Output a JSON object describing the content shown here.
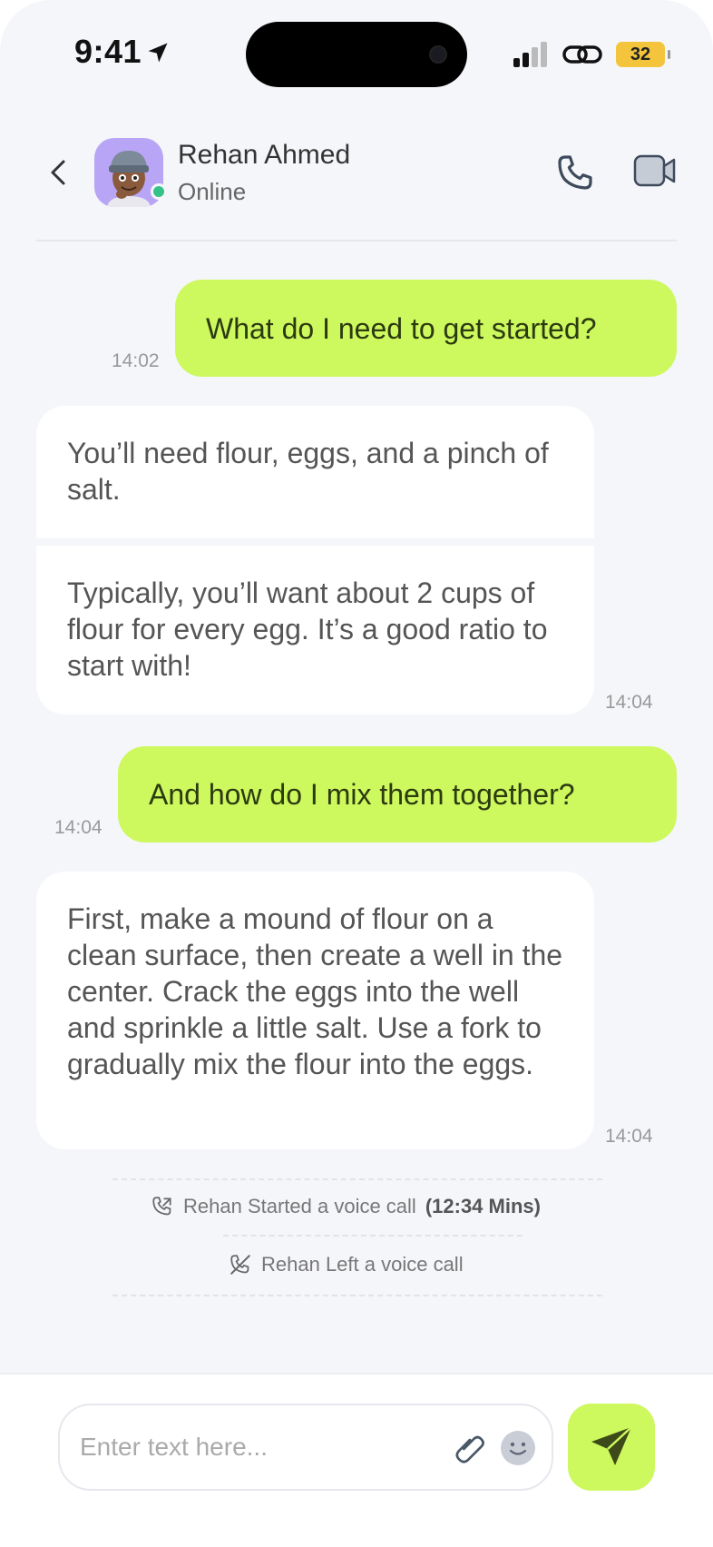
{
  "status_bar": {
    "time": "9:41",
    "battery": "32"
  },
  "header": {
    "contact_name": "Rehan Ahmed",
    "status": "Online"
  },
  "messages": [
    {
      "from": "me",
      "text": "What do I need to get started?",
      "time": "14:02"
    },
    {
      "from": "contact",
      "parts": [
        "You’ll need flour, eggs, and a pinch of salt.",
        "Typically, you’ll want about 2 cups of flour for every egg. It’s a good ratio to start with!"
      ],
      "time": "14:04"
    },
    {
      "from": "me",
      "text": "And how do I mix them together?",
      "time": "14:04"
    },
    {
      "from": "contact",
      "parts": [
        "First, make a mound of flour on a clean surface, then create a well in the center. Crack the eggs into the well and sprinkle a little salt. Use a fork to gradually mix the flour into the eggs."
      ],
      "time": "14:04"
    }
  ],
  "events": [
    {
      "text": "Rehan Started a voice call",
      "duration": "(12:34 Mins)",
      "icon": "phone-outgoing-icon"
    },
    {
      "text": "Rehan Left a voice call",
      "icon": "phone-off-icon"
    }
  ],
  "composer": {
    "placeholder": "Enter text here..."
  },
  "colors": {
    "accent": "#cdf85e",
    "online": "#35c28a",
    "background": "#f5f6fa"
  }
}
